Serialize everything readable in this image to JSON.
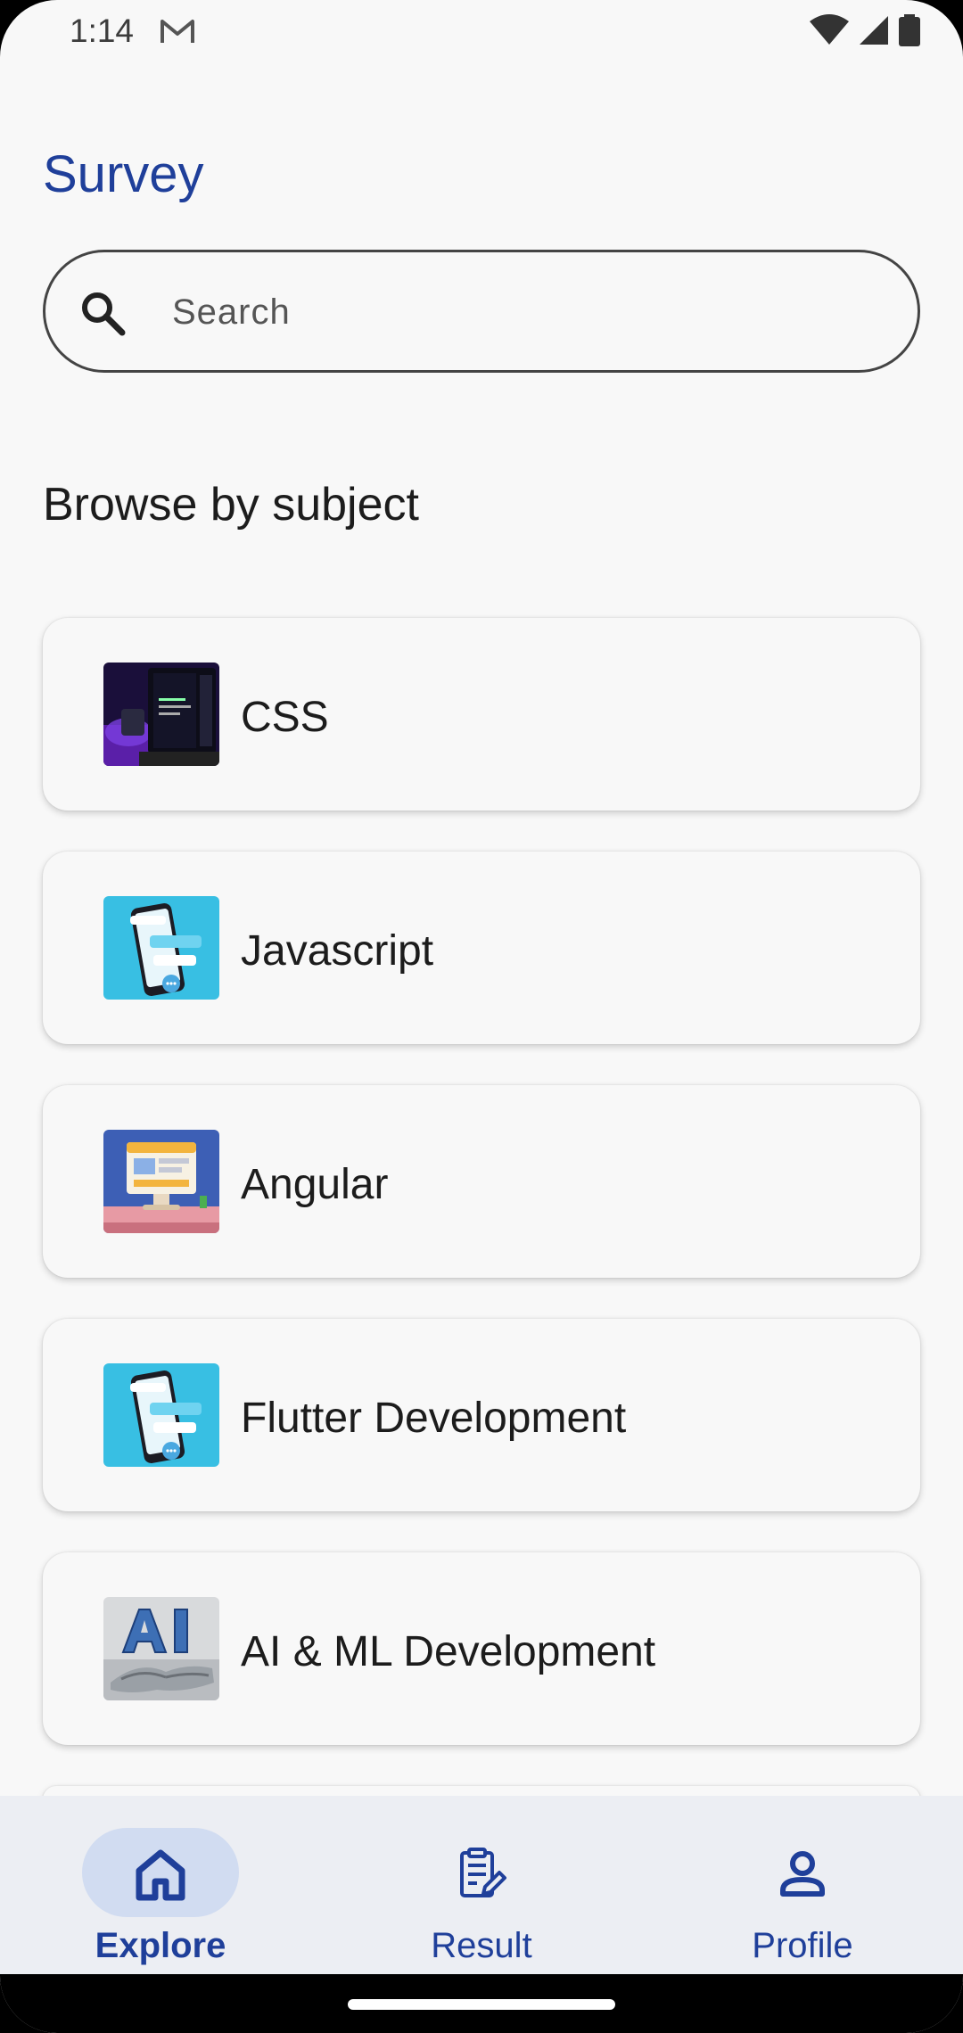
{
  "status_bar": {
    "time": "1:14"
  },
  "app": {
    "title": "Survey"
  },
  "search": {
    "placeholder": "Search"
  },
  "section": {
    "title": "Browse by subject"
  },
  "subjects": [
    {
      "label": "CSS",
      "image": "laptop-dark-image"
    },
    {
      "label": "Javascript",
      "image": "phone-chat-image"
    },
    {
      "label": "Angular",
      "image": "desktop-monitor-image"
    },
    {
      "label": "Flutter Development",
      "image": "phone-chat-image"
    },
    {
      "label": "AI & ML Development",
      "image": "ai-hand-image"
    }
  ],
  "bottom_nav": {
    "items": [
      {
        "label": "Explore",
        "icon": "home-icon",
        "active": true
      },
      {
        "label": "Result",
        "icon": "clipboard-edit-icon",
        "active": false
      },
      {
        "label": "Profile",
        "icon": "person-icon",
        "active": false
      }
    ]
  },
  "colors": {
    "accent": "#1f3f9a",
    "active_pill": "#d1dcf1",
    "nav_bg": "#eceef3",
    "background": "#f8f8f8"
  }
}
